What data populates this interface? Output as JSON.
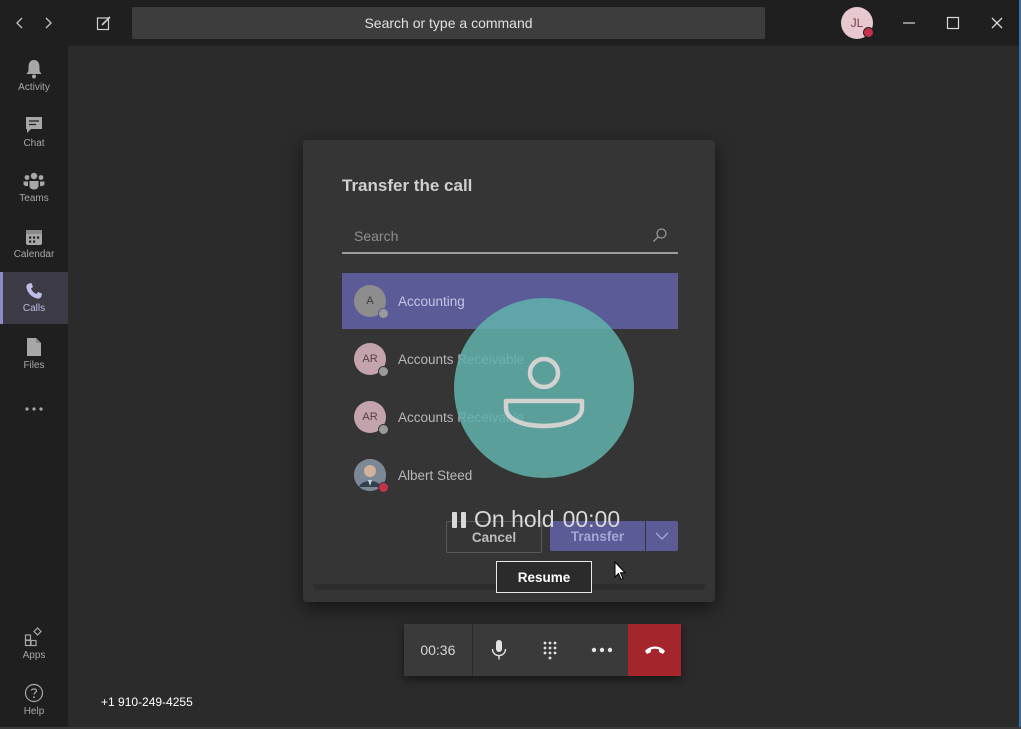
{
  "titlebar": {
    "search_placeholder": "Search or type a command",
    "avatar_initials": "JL"
  },
  "rail": {
    "items": [
      {
        "label": "Activity"
      },
      {
        "label": "Chat"
      },
      {
        "label": "Teams"
      },
      {
        "label": "Calendar"
      },
      {
        "label": "Calls"
      },
      {
        "label": "Files"
      }
    ],
    "apps_label": "Apps",
    "help_label": "Help"
  },
  "dialog": {
    "title": "Transfer the call",
    "search_placeholder": "Search",
    "contacts": [
      {
        "initials": "A",
        "name": "Accounting"
      },
      {
        "initials": "AR",
        "name": "Accounts Receivable"
      },
      {
        "initials": "AR",
        "name": "Accounts Receivable"
      },
      {
        "initials": "",
        "name": "Albert Steed"
      }
    ],
    "cancel_label": "Cancel",
    "transfer_label": "Transfer"
  },
  "hold": {
    "status": "On hold",
    "timer": "00:00",
    "resume_label": "Resume"
  },
  "callbar": {
    "duration": "00:36"
  },
  "phone_number": "+1 910-249-4255",
  "colors": {
    "accent": "#5b5c97",
    "hangup": "#a4262c",
    "busy": "#c4314b",
    "hold_circle": "#60b2ac"
  }
}
